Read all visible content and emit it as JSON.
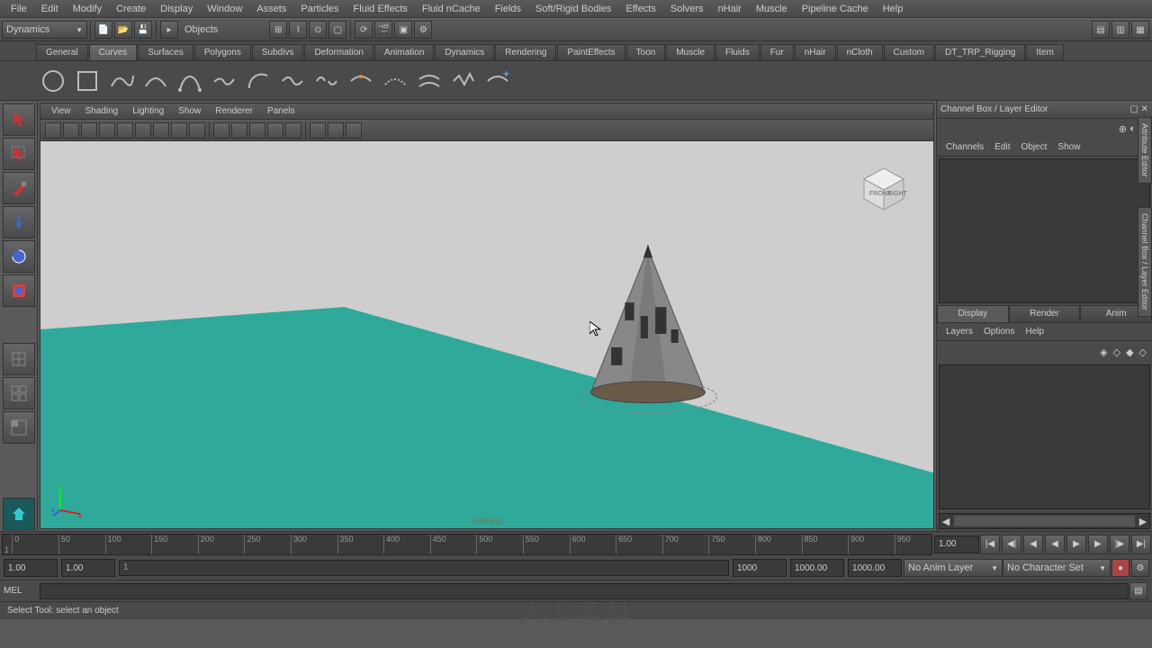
{
  "menubar": [
    "File",
    "Edit",
    "Modify",
    "Create",
    "Display",
    "Window",
    "Assets",
    "Particles",
    "Fluid Effects",
    "Fluid nCache",
    "Fields",
    "Soft/Rigid Bodies",
    "Effects",
    "Solvers",
    "nHair",
    "Muscle",
    "Pipeline Cache",
    "Help"
  ],
  "mode_dropdown": "Dynamics",
  "objects_label": "Objects",
  "shelf_tabs": [
    "General",
    "Curves",
    "Surfaces",
    "Polygons",
    "Subdivs",
    "Deformation",
    "Animation",
    "Dynamics",
    "Rendering",
    "PaintEffects",
    "Toon",
    "Muscle",
    "Fluids",
    "Fur",
    "nHair",
    "nCloth",
    "Custom",
    "DT_TRP_Rigging",
    "Item"
  ],
  "shelf_active": 1,
  "viewport_menu": [
    "View",
    "Shading",
    "Lighting",
    "Show",
    "Renderer",
    "Panels"
  ],
  "viewport_label": "persp",
  "viewcube_front": "FRONT",
  "viewcube_right": "RIGHT",
  "right_panel": {
    "title": "Channel Box / Layer Editor",
    "menu": [
      "Channels",
      "Edit",
      "Object",
      "Show"
    ],
    "layer_tabs": [
      "Display",
      "Render",
      "Anim"
    ],
    "layer_active": 0,
    "layer_menu": [
      "Layers",
      "Options",
      "Help"
    ]
  },
  "side_tabs": [
    "Attribute Editor",
    "Channel Box / Layer Editor"
  ],
  "timeline": {
    "ticks": [
      0,
      50,
      100,
      150,
      200,
      250,
      300,
      350,
      400,
      450,
      500,
      550,
      600,
      650,
      700,
      750,
      800,
      850,
      900,
      950
    ],
    "current": "1.00",
    "range_start": "1.00",
    "range_end": "1.00",
    "play_start": "1000",
    "play_end": "1000.00",
    "total": "1000.00",
    "anim_layer": "No Anim Layer",
    "char_set": "No Character Set"
  },
  "cmd_label": "MEL",
  "help_line": "Select Tool: select an object",
  "watermark": "人人素材"
}
